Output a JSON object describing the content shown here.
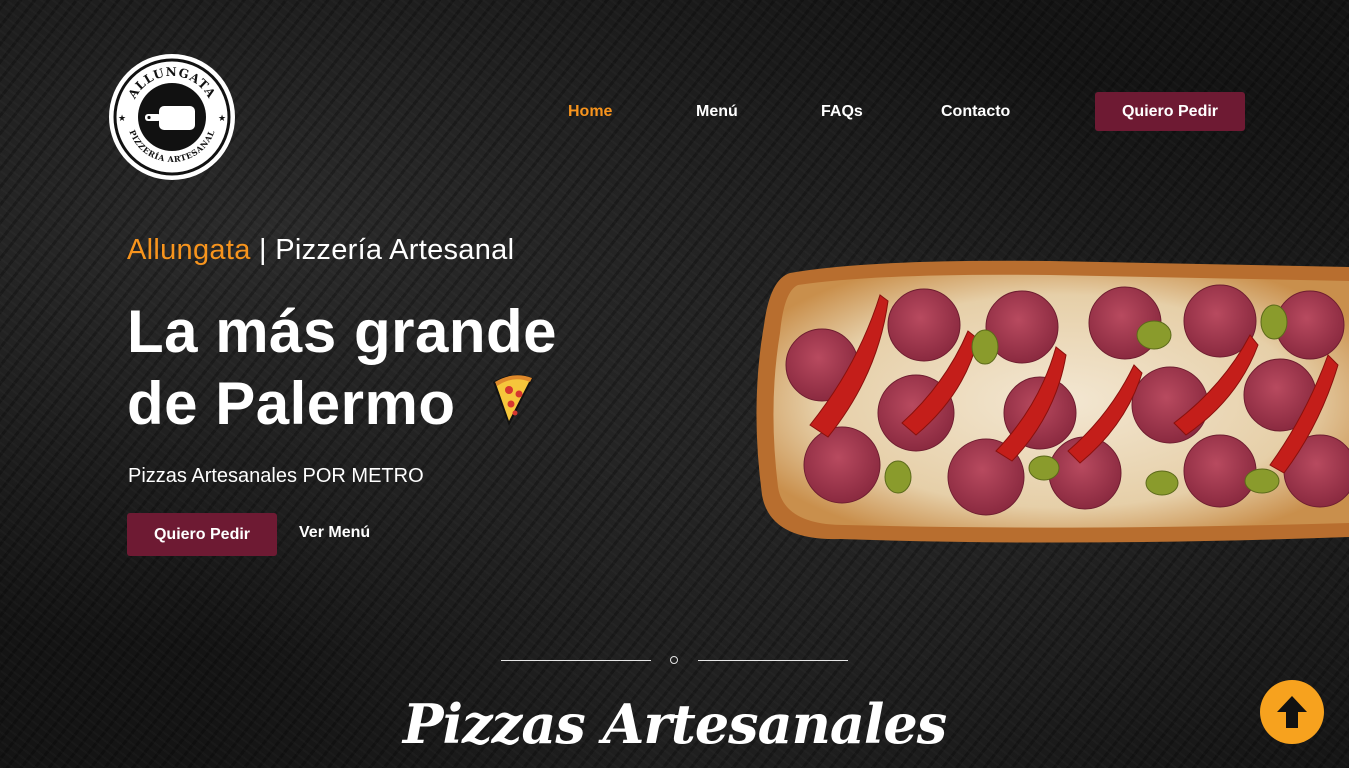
{
  "logo": {
    "top_text": "ALLUNGATA",
    "bottom_text": "PIZZERÍA ARTESANAL"
  },
  "nav": {
    "items": [
      {
        "label": "Home",
        "active": true
      },
      {
        "label": "Menú",
        "active": false
      },
      {
        "label": "FAQs",
        "active": false
      },
      {
        "label": "Contacto",
        "active": false
      }
    ],
    "cta_label": "Quiero Pedir"
  },
  "hero": {
    "brand": "Allungata",
    "separator": " | ",
    "subtitle": "Pizzería Artesanal",
    "headline_line1": "La más grande",
    "headline_line2": "de Palermo",
    "headline_emoji": "🍕",
    "tagline": "Pizzas Artesanales POR METRO",
    "primary_button": "Quiero Pedir",
    "secondary_link": "Ver Menú"
  },
  "section": {
    "title": "Pizzas Artesanales"
  },
  "icons": {
    "pizza_slice": "pizza-slice-icon",
    "scroll_top": "arrow-up-icon"
  },
  "colors": {
    "accent_orange": "#f7941d",
    "cta_burgundy": "#6e1a33",
    "scroll_button": "#f7a21e",
    "background": "#141414"
  }
}
